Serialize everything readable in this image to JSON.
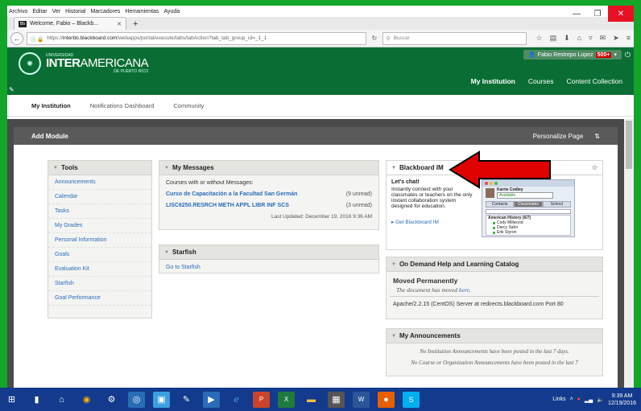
{
  "browser": {
    "menu": [
      "Archivo",
      "Editar",
      "Ver",
      "Historial",
      "Marcadores",
      "Herramientas",
      "Ayuda"
    ],
    "tab_title": "Welcome, Fabio – Blackb...",
    "tab_favicon": "Bb",
    "url_prefix": "https://",
    "url_domain": "interbb.blackboard.com",
    "url_path": "/webapps/portal/execute/tabs/tabAction?tab_tab_group_id=_1_1",
    "search_placeholder": "Buscar"
  },
  "header": {
    "logo_small": "UNIVERSIDAD",
    "logo_bold": "INTER",
    "logo_normal": "AMERICANA",
    "logo_sub": "DE PUERTO RICO",
    "user_name": "Fabio Restrepo Lopez",
    "notification_count": "500+",
    "tabs": [
      "My Institution",
      "Courses",
      "Content Collection"
    ]
  },
  "subtabs": [
    "My Institution",
    "Notifications Dashboard",
    "Community"
  ],
  "actionbar": {
    "add_module": "Add Module",
    "personalize": "Personalize Page",
    "reorder": "⇅"
  },
  "tools": {
    "title": "Tools",
    "items": [
      "Announcements",
      "Calendar",
      "Tasks",
      "My Grades",
      "Personal Information",
      "Goals",
      "Evaluation Kit",
      "Starfish",
      "Goal Performance"
    ]
  },
  "messages": {
    "title": "My Messages",
    "intro": "Courses with or without Messages:",
    "rows": [
      {
        "course": "Curso de Capacitación a la Facultad San Germán",
        "unread": "(9 unread)"
      },
      {
        "course": "LISC6250.RESRCH METH APPL LIBR INF SCS",
        "unread": "(3 unread)"
      }
    ],
    "updated": "Last Updated: December 19, 2016 9:36 AM"
  },
  "starfish": {
    "title": "Starfish",
    "link": "Go to Starfish"
  },
  "im": {
    "title": "Blackboard IM",
    "chat_title": "Let's chat!",
    "chat_text": "Instantly connect with your classmates or teachers on the only instant collaboration system designed for education.",
    "get_link": "Get Blackboard IM",
    "shot_name": "Karrie Codley",
    "shot_status": "Available",
    "shot_tabs": [
      "Contacts",
      "Classmates",
      "School"
    ],
    "shot_group": "American History (6/7)",
    "shot_people": [
      "Cody Millwood",
      "Darcy Sahn",
      "Erik Styron"
    ]
  },
  "help": {
    "title": "On Demand Help and Learning Catalog",
    "subtitle": "Moved Permanently",
    "moved_text": "The document has moved",
    "moved_link": "here",
    "footer": "Apache/2.2.15 (CentOS) Server at redirects.blackboard.com Port 80"
  },
  "announcements": {
    "title": "My Announcements",
    "empty_text": "No Institution Announcements have been posted in the last 7 days.",
    "cut_text": "No Course or Organization Announcements have been posted in the last 7"
  },
  "taskbar": {
    "links": "Links",
    "time": "9:39 AM",
    "date": "12/19/2016"
  },
  "colors": {
    "header_green": "#0a6e34",
    "taskbar": "#133a8c",
    "arrow": "#e00000",
    "link": "#2a6cb6"
  }
}
